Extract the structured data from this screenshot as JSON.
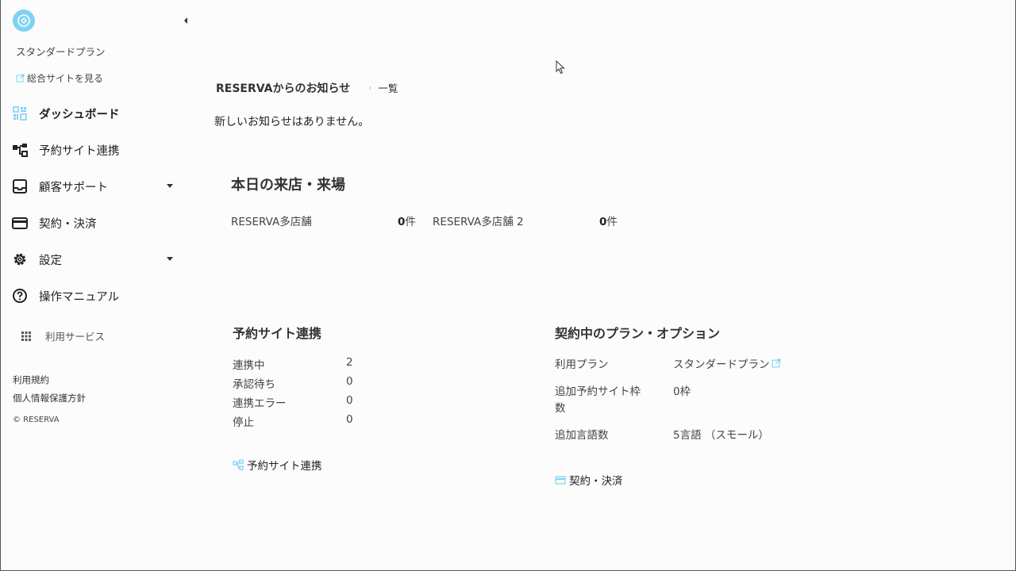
{
  "sidebar": {
    "plan_name": "スタンダードプラン",
    "site_link": "総合サイトを見る",
    "nav": [
      {
        "label": "ダッシュボード",
        "icon": "dashboard-icon"
      },
      {
        "label": "予約サイト連携",
        "icon": "sitemap-icon"
      },
      {
        "label": "顧客サポート",
        "icon": "inbox-icon"
      },
      {
        "label": "契約・決済",
        "icon": "credit-card-icon"
      },
      {
        "label": "設定",
        "icon": "gear-icon"
      },
      {
        "label": "操作マニュアル",
        "icon": "help-icon"
      }
    ],
    "services_label": "利用サービス",
    "terms": "利用規約",
    "privacy": "個人情報保護方針",
    "copyright": "© RESERVA"
  },
  "news": {
    "title": "RESERVAからのお知らせ",
    "all_link": "一覧",
    "empty": "新しいお知らせはありません。"
  },
  "today": {
    "title": "本日の来店・来場",
    "stores": [
      {
        "name": "RESERVA多店舗",
        "count": "0",
        "unit": "件"
      },
      {
        "name": "RESERVA多店舗 2",
        "count": "0",
        "unit": "件"
      }
    ]
  },
  "integration": {
    "title": "予約サイト連携",
    "rows": [
      {
        "label": "連携中",
        "value": "2"
      },
      {
        "label": "承認待ち",
        "value": "0"
      },
      {
        "label": "連携エラー",
        "value": "0"
      },
      {
        "label": "停止",
        "value": "0"
      }
    ],
    "link": "予約サイト連携"
  },
  "contract": {
    "title": "契約中のプラン・オプション",
    "plan_label": "利用プラン",
    "plan_value": "スタンダードプラン",
    "extra_label_1": "追加予約サイト枠",
    "extra_label_2": "数",
    "extra_value": "0枠",
    "lang_label": "追加言語数",
    "lang_value": "5言語 （スモール）",
    "link": "契約・決済"
  },
  "colors": {
    "accent": "#7ed3f3"
  }
}
